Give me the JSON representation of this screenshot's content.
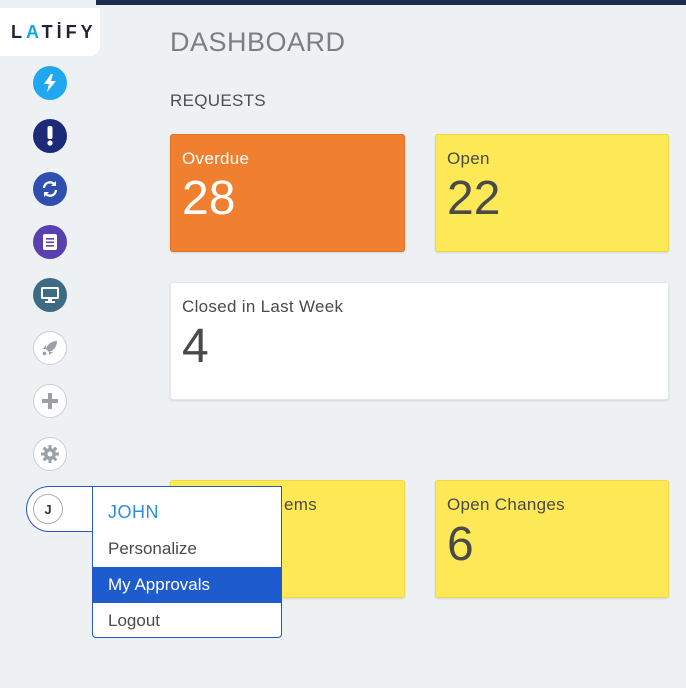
{
  "brand": {
    "logo_part1": "L",
    "logo_accent": "A",
    "logo_part2": "TİFY"
  },
  "colors": {
    "overdue": "#f07f30",
    "open": "#fde955",
    "accent_blue": "#1d5bcf",
    "link_blue": "#2a8ee0"
  },
  "sidebar": {
    "icons": [
      {
        "name": "lightning-icon",
        "color": "#1fa8f0"
      },
      {
        "name": "exclamation-icon",
        "color": "#1c2a78"
      },
      {
        "name": "refresh-icon",
        "color": "#2f4fb0"
      },
      {
        "name": "book-icon",
        "color": "#5a3fb0"
      },
      {
        "name": "monitor-icon",
        "color": "#3c6b83"
      },
      {
        "name": "rocket-icon",
        "color": "#9aa0a6"
      },
      {
        "name": "plus-icon",
        "color": "#9aa0a6"
      },
      {
        "name": "gear-icon",
        "color": "#9aa0a6"
      }
    ]
  },
  "header": {
    "title": "DASHBOARD"
  },
  "requests": {
    "title": "REQUESTS",
    "overdue": {
      "label": "Overdue",
      "count": "28"
    },
    "open": {
      "label": "Open",
      "count": "22"
    },
    "closed": {
      "label": "Closed in Last Week",
      "count": "4"
    },
    "work_items": {
      "label": "ems"
    },
    "open_changes": {
      "label": "Open Changes",
      "count": "6"
    }
  },
  "user": {
    "initial": "J",
    "name": "JOHN",
    "menu": [
      "Personalize",
      "My Approvals",
      "Logout"
    ],
    "selected": "My Approvals"
  }
}
